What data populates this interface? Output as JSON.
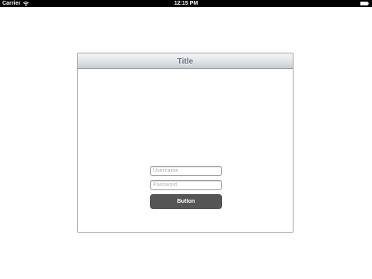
{
  "status_bar": {
    "carrier": "Carrier",
    "time": "12:15 PM",
    "icons": [
      "wifi-icon",
      "battery-icon"
    ]
  },
  "panel": {
    "title": "Title",
    "username_placeholder": "Username",
    "password_placeholder": "Password",
    "button_label": "Button"
  },
  "colors": {
    "status_bar_bg": "#000000",
    "button_bg": "#555555",
    "title_text": "#6d747c",
    "page_bg": "#ffffff"
  }
}
